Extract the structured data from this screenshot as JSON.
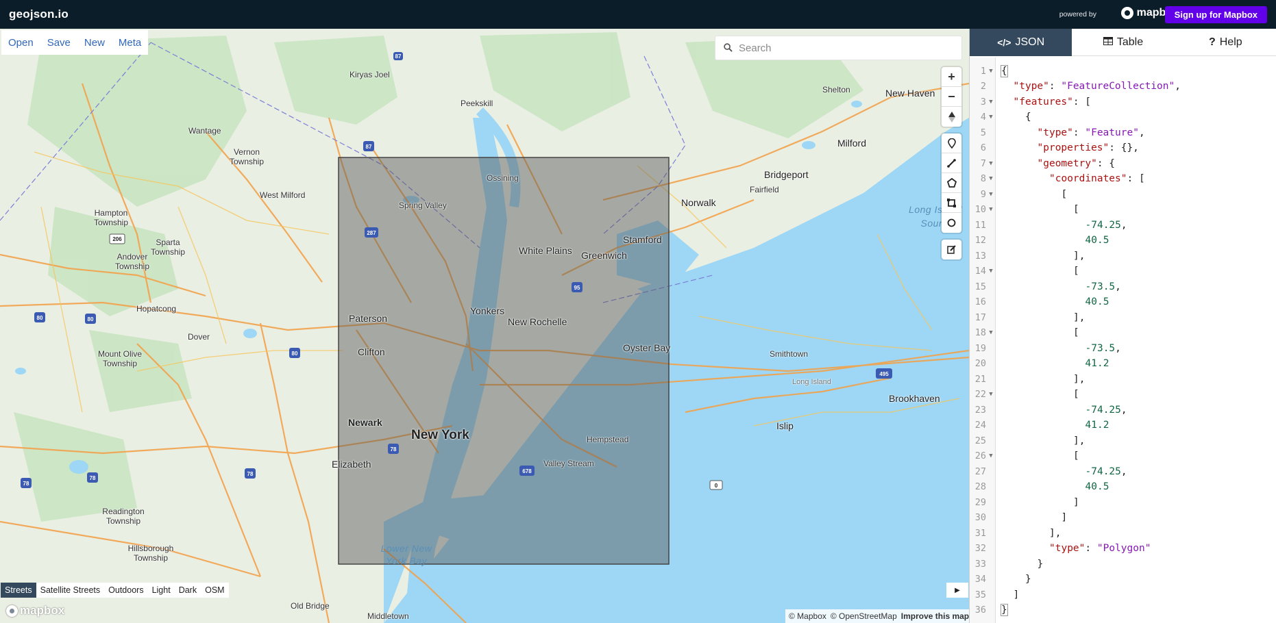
{
  "topbar": {
    "brand": "geojson.io",
    "powered_by": "powered by",
    "mapbox_logo": "mapbox",
    "signup": "Sign up for Mapbox"
  },
  "file_menu": [
    "Open",
    "Save",
    "New",
    "Meta"
  ],
  "search": {
    "placeholder": "Search"
  },
  "map_controls": {
    "zoom": [
      "zoom-in-icon",
      "zoom-out-icon",
      "compass-icon"
    ],
    "draw": [
      "marker-icon",
      "line-icon",
      "polygon-icon",
      "rectangle-icon",
      "circle-icon"
    ],
    "edit": [
      "edit-icon"
    ]
  },
  "map_styles": {
    "items": [
      "Streets",
      "Satellite Streets",
      "Outdoors",
      "Light",
      "Dark",
      "OSM"
    ],
    "active": "Streets"
  },
  "attribution": {
    "mapbox": "© Mapbox",
    "osm": "© OpenStreetMap",
    "improve": "Improve this map"
  },
  "wordmark": "mapbox",
  "map_labels": {
    "places": [
      "Kiryas Joel",
      "Peekskill",
      "Wantage",
      "Vernon Township",
      "West Milford",
      "Hampton Township",
      "Sparta Township",
      "Andover Township",
      "Hopatcong",
      "Dover",
      "Mount Olive Township",
      "Readington Township",
      "Hillsborough Township",
      "Old Bridge",
      "Middletown",
      "Ossining",
      "Spring Valley",
      "White Plains",
      "Greenwich",
      "Stamford",
      "Norwalk",
      "Fairfield",
      "Bridgeport",
      "Milford",
      "New Haven",
      "Shelton",
      "Paterson",
      "Clifton",
      "Yonkers",
      "New Rochelle",
      "Oyster Bay",
      "Smithtown",
      "Long Island",
      "Brookhaven",
      "Islip",
      "Hempstead",
      "Valley Stream",
      "Elizabeth",
      "Newark",
      "New York"
    ],
    "water": [
      "Long Island Sound",
      "Lower New York Bay"
    ],
    "shields": [
      "87",
      "287",
      "95",
      "80",
      "80",
      "80",
      "78",
      "78",
      "78",
      "78",
      "206",
      "495",
      "678",
      "0",
      "95"
    ]
  },
  "panel": {
    "tabs": [
      {
        "icon": "code-icon",
        "label": "JSON"
      },
      {
        "icon": "table-icon",
        "label": "Table"
      },
      {
        "icon": "help-icon",
        "label": "Help"
      }
    ],
    "active_tab": "JSON",
    "code_lines": [
      {
        "n": "1",
        "fold": true,
        "indent": 0,
        "parts": [
          [
            "p",
            "{"
          ]
        ]
      },
      {
        "n": "2",
        "fold": false,
        "indent": 1,
        "parts": [
          [
            "k",
            "\"type\""
          ],
          [
            "p",
            ": "
          ],
          [
            "s",
            "\"FeatureCollection\""
          ],
          [
            "p",
            ","
          ]
        ]
      },
      {
        "n": "3",
        "fold": true,
        "indent": 1,
        "parts": [
          [
            "k",
            "\"features\""
          ],
          [
            "p",
            ": ["
          ]
        ]
      },
      {
        "n": "4",
        "fold": true,
        "indent": 2,
        "parts": [
          [
            "p",
            "{"
          ]
        ]
      },
      {
        "n": "5",
        "fold": false,
        "indent": 3,
        "parts": [
          [
            "k",
            "\"type\""
          ],
          [
            "p",
            ": "
          ],
          [
            "s",
            "\"Feature\""
          ],
          [
            "p",
            ","
          ]
        ]
      },
      {
        "n": "6",
        "fold": false,
        "indent": 3,
        "parts": [
          [
            "k",
            "\"properties\""
          ],
          [
            "p",
            ": {},"
          ]
        ]
      },
      {
        "n": "7",
        "fold": true,
        "indent": 3,
        "parts": [
          [
            "k",
            "\"geometry\""
          ],
          [
            "p",
            ": {"
          ]
        ]
      },
      {
        "n": "8",
        "fold": true,
        "indent": 4,
        "parts": [
          [
            "k",
            "\"coordinates\""
          ],
          [
            "p",
            ": ["
          ]
        ]
      },
      {
        "n": "9",
        "fold": true,
        "indent": 5,
        "parts": [
          [
            "p",
            "["
          ]
        ]
      },
      {
        "n": "10",
        "fold": true,
        "indent": 6,
        "parts": [
          [
            "p",
            "["
          ]
        ]
      },
      {
        "n": "11",
        "fold": false,
        "indent": 7,
        "parts": [
          [
            "n",
            "-74.25"
          ],
          [
            "p",
            ","
          ]
        ]
      },
      {
        "n": "12",
        "fold": false,
        "indent": 7,
        "parts": [
          [
            "n",
            "40.5"
          ]
        ]
      },
      {
        "n": "13",
        "fold": false,
        "indent": 6,
        "parts": [
          [
            "p",
            "],"
          ]
        ]
      },
      {
        "n": "14",
        "fold": true,
        "indent": 6,
        "parts": [
          [
            "p",
            "["
          ]
        ]
      },
      {
        "n": "15",
        "fold": false,
        "indent": 7,
        "parts": [
          [
            "n",
            "-73.5"
          ],
          [
            "p",
            ","
          ]
        ]
      },
      {
        "n": "16",
        "fold": false,
        "indent": 7,
        "parts": [
          [
            "n",
            "40.5"
          ]
        ]
      },
      {
        "n": "17",
        "fold": false,
        "indent": 6,
        "parts": [
          [
            "p",
            "],"
          ]
        ]
      },
      {
        "n": "18",
        "fold": true,
        "indent": 6,
        "parts": [
          [
            "p",
            "["
          ]
        ]
      },
      {
        "n": "19",
        "fold": false,
        "indent": 7,
        "parts": [
          [
            "n",
            "-73.5"
          ],
          [
            "p",
            ","
          ]
        ]
      },
      {
        "n": "20",
        "fold": false,
        "indent": 7,
        "parts": [
          [
            "n",
            "41.2"
          ]
        ]
      },
      {
        "n": "21",
        "fold": false,
        "indent": 6,
        "parts": [
          [
            "p",
            "],"
          ]
        ]
      },
      {
        "n": "22",
        "fold": true,
        "indent": 6,
        "parts": [
          [
            "p",
            "["
          ]
        ]
      },
      {
        "n": "23",
        "fold": false,
        "indent": 7,
        "parts": [
          [
            "n",
            "-74.25"
          ],
          [
            "p",
            ","
          ]
        ]
      },
      {
        "n": "24",
        "fold": false,
        "indent": 7,
        "parts": [
          [
            "n",
            "41.2"
          ]
        ]
      },
      {
        "n": "25",
        "fold": false,
        "indent": 6,
        "parts": [
          [
            "p",
            "],"
          ]
        ]
      },
      {
        "n": "26",
        "fold": true,
        "indent": 6,
        "parts": [
          [
            "p",
            "["
          ]
        ]
      },
      {
        "n": "27",
        "fold": false,
        "indent": 7,
        "parts": [
          [
            "n",
            "-74.25"
          ],
          [
            "p",
            ","
          ]
        ]
      },
      {
        "n": "28",
        "fold": false,
        "indent": 7,
        "parts": [
          [
            "n",
            "40.5"
          ]
        ]
      },
      {
        "n": "29",
        "fold": false,
        "indent": 6,
        "parts": [
          [
            "p",
            "]"
          ]
        ]
      },
      {
        "n": "30",
        "fold": false,
        "indent": 5,
        "parts": [
          [
            "p",
            "]"
          ]
        ]
      },
      {
        "n": "31",
        "fold": false,
        "indent": 4,
        "parts": [
          [
            "p",
            "],"
          ]
        ]
      },
      {
        "n": "32",
        "fold": false,
        "indent": 4,
        "parts": [
          [
            "k",
            "\"type\""
          ],
          [
            "p",
            ": "
          ],
          [
            "s",
            "\"Polygon\""
          ]
        ]
      },
      {
        "n": "33",
        "fold": false,
        "indent": 3,
        "parts": [
          [
            "p",
            "}"
          ]
        ]
      },
      {
        "n": "34",
        "fold": false,
        "indent": 2,
        "parts": [
          [
            "p",
            "}"
          ]
        ]
      },
      {
        "n": "35",
        "fold": false,
        "indent": 1,
        "parts": [
          [
            "p",
            "]"
          ]
        ]
      },
      {
        "n": "36",
        "fold": false,
        "indent": 0,
        "parts": [
          [
            "p",
            "}"
          ]
        ]
      }
    ]
  },
  "colors": {
    "topbar": "#0c1d2a",
    "signup": "#6200ea",
    "tab_active": "#34495e",
    "link": "#3067b8",
    "water": "#9dd7f5",
    "polygon_fill": "#555555"
  }
}
